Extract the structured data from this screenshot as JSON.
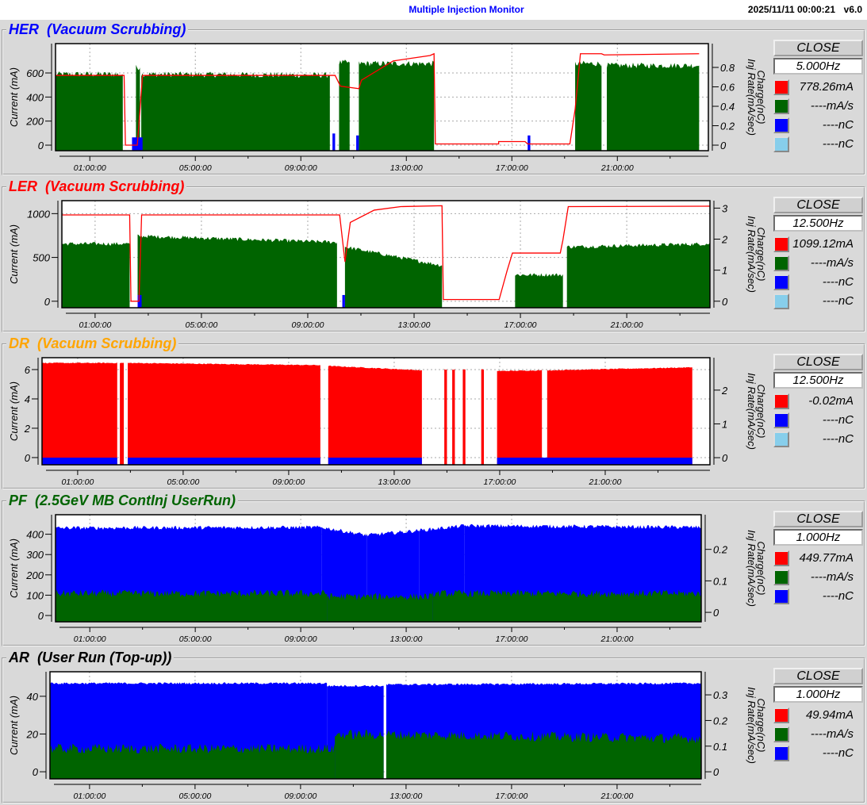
{
  "header": {
    "title": "Multiple Injection Monitor",
    "datetime": "2025/11/11 00:00:21",
    "version": "v6.0"
  },
  "panels": [
    {
      "name": "HER",
      "subtitle": "(Vacuum Scrubbing)",
      "title_color": "#0000ff",
      "close_label": "CLOSE",
      "rate": "5.000Hz",
      "legend": [
        {
          "color": "#ff0000",
          "value": "778.26mA"
        },
        {
          "color": "#006400",
          "value": "----mA/s"
        },
        {
          "color": "#0000ff",
          "value": "----nC"
        },
        {
          "color": "#87ceeb",
          "value": "----nC"
        }
      ]
    },
    {
      "name": "LER",
      "subtitle": "(Vacuum Scrubbing)",
      "title_color": "#ff0000",
      "close_label": "CLOSE",
      "rate": "12.500Hz",
      "legend": [
        {
          "color": "#ff0000",
          "value": "1099.12mA"
        },
        {
          "color": "#006400",
          "value": "----mA/s"
        },
        {
          "color": "#0000ff",
          "value": "----nC"
        },
        {
          "color": "#87ceeb",
          "value": "----nC"
        }
      ]
    },
    {
      "name": "DR",
      "subtitle": "(Vacuum Scrubbing)",
      "title_color": "#ffa500",
      "close_label": "CLOSE",
      "rate": "12.500Hz",
      "legend": [
        {
          "color": "#ff0000",
          "value": "-0.02mA"
        },
        {
          "color": "#0000ff",
          "value": "----nC"
        },
        {
          "color": "#87ceeb",
          "value": "----nC"
        }
      ]
    },
    {
      "name": "PF",
      "subtitle": "(2.5GeV MB ContInj UserRun)",
      "title_color": "#006400",
      "close_label": "CLOSE",
      "rate": "1.000Hz",
      "legend": [
        {
          "color": "#ff0000",
          "value": "449.77mA"
        },
        {
          "color": "#006400",
          "value": "----mA/s"
        },
        {
          "color": "#0000ff",
          "value": "----nC"
        }
      ]
    },
    {
      "name": "AR",
      "subtitle": "(User Run (Top-up))",
      "title_color": "#000000",
      "close_label": "CLOSE",
      "rate": "1.000Hz",
      "legend": [
        {
          "color": "#ff0000",
          "value": "49.94mA"
        },
        {
          "color": "#006400",
          "value": "----mA/s"
        },
        {
          "color": "#0000ff",
          "value": "----nC"
        }
      ]
    }
  ],
  "chart_data": [
    {
      "type": "area",
      "title": "HER (Vacuum Scrubbing)",
      "ylabel": "Current (mA)",
      "y2label": [
        "Charge(nC)",
        "Inj Rate(mA/sec)"
      ],
      "xlabel_unit": "hours",
      "xlim": [
        -0.3,
        24.45
      ],
      "xticks": [
        1,
        5,
        9,
        13,
        17,
        21
      ],
      "xtick_labels": [
        "01:00:00",
        "05:00:00",
        "09:00:00",
        "13:00:00",
        "17:00:00",
        "21:00:00"
      ],
      "ylim": [
        -46,
        844
      ],
      "yticks": [
        0,
        200,
        400,
        600
      ],
      "y2lim": [
        -0.057,
        1.045
      ],
      "y2ticks": [
        0,
        0.2,
        0.4,
        0.6,
        0.8
      ],
      "grid": true,
      "series": [
        {
          "name": "inj_rate",
          "kind": "fill",
          "axis": "right",
          "color": "#006400",
          "noise": 0.03,
          "segments": [
            [
              -0.3,
              2.25,
              0.73,
              0.73
            ],
            [
              2.75,
              2.9,
              0.8,
              0.8
            ],
            [
              2.95,
              10.1,
              0.73,
              0.72
            ],
            [
              10.45,
              10.85,
              0.85,
              0.85
            ],
            [
              11.2,
              14.05,
              0.84,
              0.84
            ],
            [
              19.4,
              20.4,
              0.84,
              0.84
            ],
            [
              20.6,
              24.1,
              0.82,
              0.82
            ]
          ]
        },
        {
          "name": "charge",
          "kind": "fill",
          "axis": "right",
          "color": "#0000ff",
          "noise": 0.0,
          "segments": [
            [
              2.6,
              3.0,
              0.08,
              0.08
            ],
            [
              10.2,
              10.3,
              0.12,
              0.12
            ],
            [
              11.1,
              11.2,
              0.1,
              0.1
            ],
            [
              17.6,
              17.7,
              0.1,
              0.1
            ]
          ]
        },
        {
          "name": "current",
          "kind": "line",
          "axis": "left",
          "color": "#ff0000",
          "points": [
            [
              -0.3,
              580
            ],
            [
              2.3,
              580
            ],
            [
              2.35,
              0
            ],
            [
              2.8,
              0
            ],
            [
              3.0,
              580
            ],
            [
              10.3,
              580
            ],
            [
              10.5,
              490
            ],
            [
              11.2,
              470
            ],
            [
              11.3,
              540
            ],
            [
              12.5,
              700
            ],
            [
              13.9,
              745
            ],
            [
              14.05,
              760
            ],
            [
              14.1,
              10
            ],
            [
              16.5,
              10
            ],
            [
              16.5,
              30
            ],
            [
              17.5,
              30
            ],
            [
              17.6,
              10
            ],
            [
              19.2,
              10
            ],
            [
              19.4,
              300
            ],
            [
              19.6,
              760
            ],
            [
              20.4,
              760
            ],
            [
              20.5,
              750
            ],
            [
              24.1,
              760
            ]
          ]
        }
      ]
    },
    {
      "type": "area",
      "title": "LER (Vacuum Scrubbing)",
      "ylabel": "Current (mA)",
      "y2label": [
        "Charge(nC)",
        "Inj Rate(mA/sec)"
      ],
      "xlabel_unit": "hours",
      "xlim": [
        -0.25,
        24.13
      ],
      "xticks": [
        1,
        5,
        9,
        13,
        17,
        21
      ],
      "xtick_labels": [
        "01:00:00",
        "05:00:00",
        "09:00:00",
        "13:00:00",
        "17:00:00",
        "21:00:00"
      ],
      "ylim": [
        -74,
        1148
      ],
      "yticks": [
        0,
        500,
        1000
      ],
      "y2lim": [
        -0.21,
        3.24
      ],
      "y2ticks": [
        0,
        1,
        2,
        3
      ],
      "grid": true,
      "series": [
        {
          "name": "inj_rate",
          "kind": "fill",
          "axis": "right",
          "color": "#006400",
          "noise": 0.06,
          "segments": [
            [
              -0.25,
              2.3,
              1.85,
              1.85
            ],
            [
              2.6,
              10.1,
              2.1,
              1.9
            ],
            [
              10.4,
              14.05,
              1.75,
              1.15
            ],
            [
              16.8,
              18.6,
              0.85,
              0.85
            ],
            [
              18.75,
              24.13,
              1.75,
              1.85
            ]
          ]
        },
        {
          "name": "charge",
          "kind": "fill",
          "axis": "right",
          "color": "#0000ff",
          "noise": 0.0,
          "segments": [
            [
              2.6,
              2.75,
              0.2,
              0.2
            ],
            [
              10.3,
              10.4,
              0.2,
              0.2
            ]
          ]
        },
        {
          "name": "current",
          "kind": "line",
          "axis": "left",
          "color": "#ff0000",
          "points": [
            [
              -0.25,
              985
            ],
            [
              2.3,
              985
            ],
            [
              2.35,
              0
            ],
            [
              2.65,
              0
            ],
            [
              2.75,
              985
            ],
            [
              10.2,
              985
            ],
            [
              10.4,
              450
            ],
            [
              10.6,
              900
            ],
            [
              11.5,
              1040
            ],
            [
              12.5,
              1080
            ],
            [
              14.05,
              1090
            ],
            [
              14.1,
              20
            ],
            [
              16.2,
              20
            ],
            [
              16.5,
              350
            ],
            [
              16.7,
              550
            ],
            [
              18.5,
              550
            ],
            [
              18.6,
              700
            ],
            [
              18.8,
              1080
            ],
            [
              24.13,
              1085
            ]
          ]
        }
      ]
    },
    {
      "type": "area",
      "title": "DR (Vacuum Scrubbing)",
      "ylabel": "Current (mA)",
      "y2label": [
        "Charge(nC)",
        "Inj Rate(mA/sec)"
      ],
      "xlabel_unit": "hours",
      "xlim": [
        -0.35,
        24.97
      ],
      "xticks": [
        1,
        5,
        9,
        13,
        17,
        21
      ],
      "xtick_labels": [
        "01:00:00",
        "05:00:00",
        "09:00:00",
        "13:00:00",
        "17:00:00",
        "21:00:00"
      ],
      "ylim": [
        -0.49,
        6.81
      ],
      "yticks": [
        0,
        2,
        4,
        6
      ],
      "y2lim": [
        -0.21,
        2.96
      ],
      "y2ticks": [
        0,
        1,
        2
      ],
      "grid": true,
      "series": [
        {
          "name": "current",
          "kind": "fill",
          "axis": "left",
          "color": "#ff0000",
          "noise": 0.03,
          "segments": [
            [
              -0.35,
              2.5,
              6.45,
              6.45
            ],
            [
              2.6,
              2.75,
              6.45,
              6.45
            ],
            [
              2.9,
              10.2,
              6.45,
              6.3
            ],
            [
              10.5,
              14.05,
              6.25,
              5.95
            ],
            [
              14.9,
              15.0,
              6.0,
              6.0
            ],
            [
              15.2,
              15.3,
              6.0,
              6.0
            ],
            [
              15.6,
              15.7,
              6.0,
              6.0
            ],
            [
              16.3,
              16.4,
              6.0,
              6.0
            ],
            [
              16.9,
              18.6,
              5.9,
              5.95
            ],
            [
              18.8,
              24.3,
              5.95,
              6.15
            ]
          ]
        },
        {
          "name": "charge",
          "kind": "fill",
          "axis": "right",
          "color": "#0000ff",
          "noise": 0.0,
          "segments": [
            [
              -0.35,
              2.5,
              0.0,
              0.0
            ],
            [
              2.9,
              10.2,
              0.0,
              0.0
            ],
            [
              10.5,
              14.05,
              0.0,
              0.0
            ],
            [
              16.9,
              24.3,
              0.0,
              0.0
            ]
          ]
        }
      ]
    },
    {
      "type": "area",
      "title": "PF (2.5GeV MB ContInj UserRun)",
      "ylabel": "Current (mA)",
      "y2label": [
        "Charge(nC)",
        "Inj Rate(mA/sec)"
      ],
      "xlabel_unit": "hours",
      "xlim": [
        -0.3,
        24.19
      ],
      "xticks": [
        1,
        5,
        9,
        13,
        17,
        21
      ],
      "xtick_labels": [
        "01:00:00",
        "05:00:00",
        "09:00:00",
        "13:00:00",
        "17:00:00",
        "21:00:00"
      ],
      "ylim": [
        -31,
        496
      ],
      "yticks": [
        0,
        100,
        200,
        300,
        400
      ],
      "y2lim": [
        -0.03,
        0.31
      ],
      "y2ticks": [
        0,
        0.1,
        0.2
      ],
      "grid": true,
      "series": [
        {
          "name": "charge",
          "kind": "fill",
          "axis": "right",
          "color": "#0000ff",
          "noise": 0.006,
          "segments": [
            [
              -0.3,
              9.8,
              0.268,
              0.27
            ],
            [
              9.8,
              11.5,
              0.27,
              0.245
            ],
            [
              11.5,
              13.5,
              0.245,
              0.26
            ],
            [
              13.5,
              15.2,
              0.26,
              0.275
            ],
            [
              15.2,
              24.19,
              0.275,
              0.27
            ]
          ]
        },
        {
          "name": "inj_rate",
          "kind": "fill",
          "axis": "right",
          "color": "#006400",
          "noise": 0.012,
          "segments": [
            [
              -0.3,
              10.0,
              0.06,
              0.06
            ],
            [
              10.0,
              14.0,
              0.05,
              0.05
            ],
            [
              14.0,
              24.19,
              0.06,
              0.06
            ]
          ]
        }
      ]
    },
    {
      "type": "area",
      "title": "AR (User Run (Top-up))",
      "ylabel": "Current (mA)",
      "y2label": [
        "Charge(nC)",
        "Inj Rate(mA/sec)"
      ],
      "xlabel_unit": "hours",
      "xlim": [
        -0.5,
        24.19
      ],
      "xticks": [
        1,
        5,
        9,
        13,
        17,
        21
      ],
      "xtick_labels": [
        "01:00:00",
        "05:00:00",
        "09:00:00",
        "13:00:00",
        "17:00:00",
        "21:00:00"
      ],
      "ylim": [
        -3.75,
        53
      ],
      "yticks": [
        0,
        20,
        40
      ],
      "y2lim": [
        -0.0275,
        0.39
      ],
      "y2ticks": [
        0,
        0.1,
        0.2,
        0.3
      ],
      "grid": true,
      "series": [
        {
          "name": "charge",
          "kind": "fill",
          "axis": "right",
          "color": "#0000ff",
          "noise": 0.004,
          "segments": [
            [
              -0.5,
              10.0,
              0.345,
              0.345
            ],
            [
              10.0,
              12.15,
              0.335,
              0.335
            ],
            [
              12.25,
              24.19,
              0.34,
              0.345
            ]
          ]
        },
        {
          "name": "inj_rate",
          "kind": "fill",
          "axis": "right",
          "color": "#006400",
          "noise": 0.02,
          "segments": [
            [
              -0.5,
              10.3,
              0.09,
              0.09
            ],
            [
              10.3,
              12.15,
              0.145,
              0.145
            ],
            [
              12.25,
              24.19,
              0.145,
              0.13
            ]
          ]
        }
      ]
    }
  ]
}
